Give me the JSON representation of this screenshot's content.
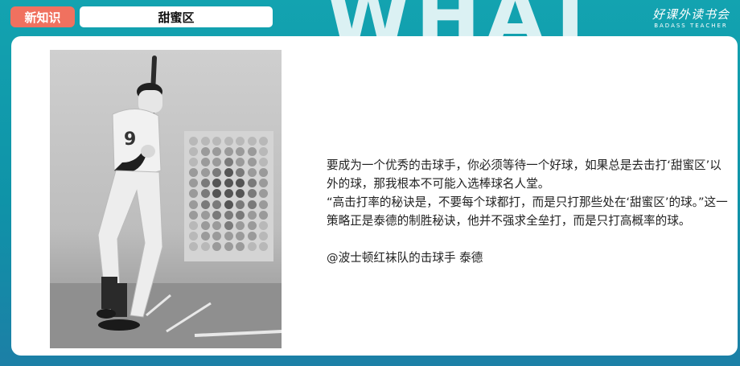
{
  "header": {
    "tag": "新知识",
    "title": "甜蜜区",
    "background_word": "WHAT"
  },
  "logo": {
    "mark": "好课外读书会",
    "sub": "BADASS TEACHER"
  },
  "photo": {
    "jersey_number": "9",
    "strike_zone": {
      "rows": 11,
      "cols": 7,
      "levels": [
        [
          0,
          0,
          0,
          0,
          0,
          0,
          0
        ],
        [
          0,
          1,
          1,
          1,
          1,
          1,
          0
        ],
        [
          0,
          1,
          1,
          2,
          1,
          1,
          0
        ],
        [
          1,
          1,
          2,
          3,
          2,
          1,
          1
        ],
        [
          1,
          2,
          3,
          3,
          3,
          2,
          1
        ],
        [
          1,
          2,
          3,
          3,
          3,
          2,
          1
        ],
        [
          1,
          2,
          2,
          3,
          2,
          2,
          1
        ],
        [
          1,
          1,
          2,
          2,
          2,
          1,
          1
        ],
        [
          0,
          1,
          1,
          2,
          1,
          1,
          0
        ],
        [
          0,
          1,
          1,
          1,
          1,
          1,
          0
        ],
        [
          0,
          0,
          1,
          1,
          1,
          0,
          0
        ]
      ],
      "shade_colors": [
        "#b8b8b8",
        "#9a9a9a",
        "#7a7a7a",
        "#555555"
      ]
    }
  },
  "quote": {
    "lines": [
      "要成为一个优秀的击球手，你必须等待一个好球，如果总是去击打‘甜蜜区’以外的球，那我根本不可能入选棒球名人堂。",
      "“高击打率的秘诀是，不要每个球都打，而是只打那些处在‘甜蜜区’的球。”这一策略正是泰德的制胜秘诀，他并不强求全垒打，而是只打高概率的球。"
    ],
    "attribution": "@波士顿红袜队的击球手 泰德"
  }
}
